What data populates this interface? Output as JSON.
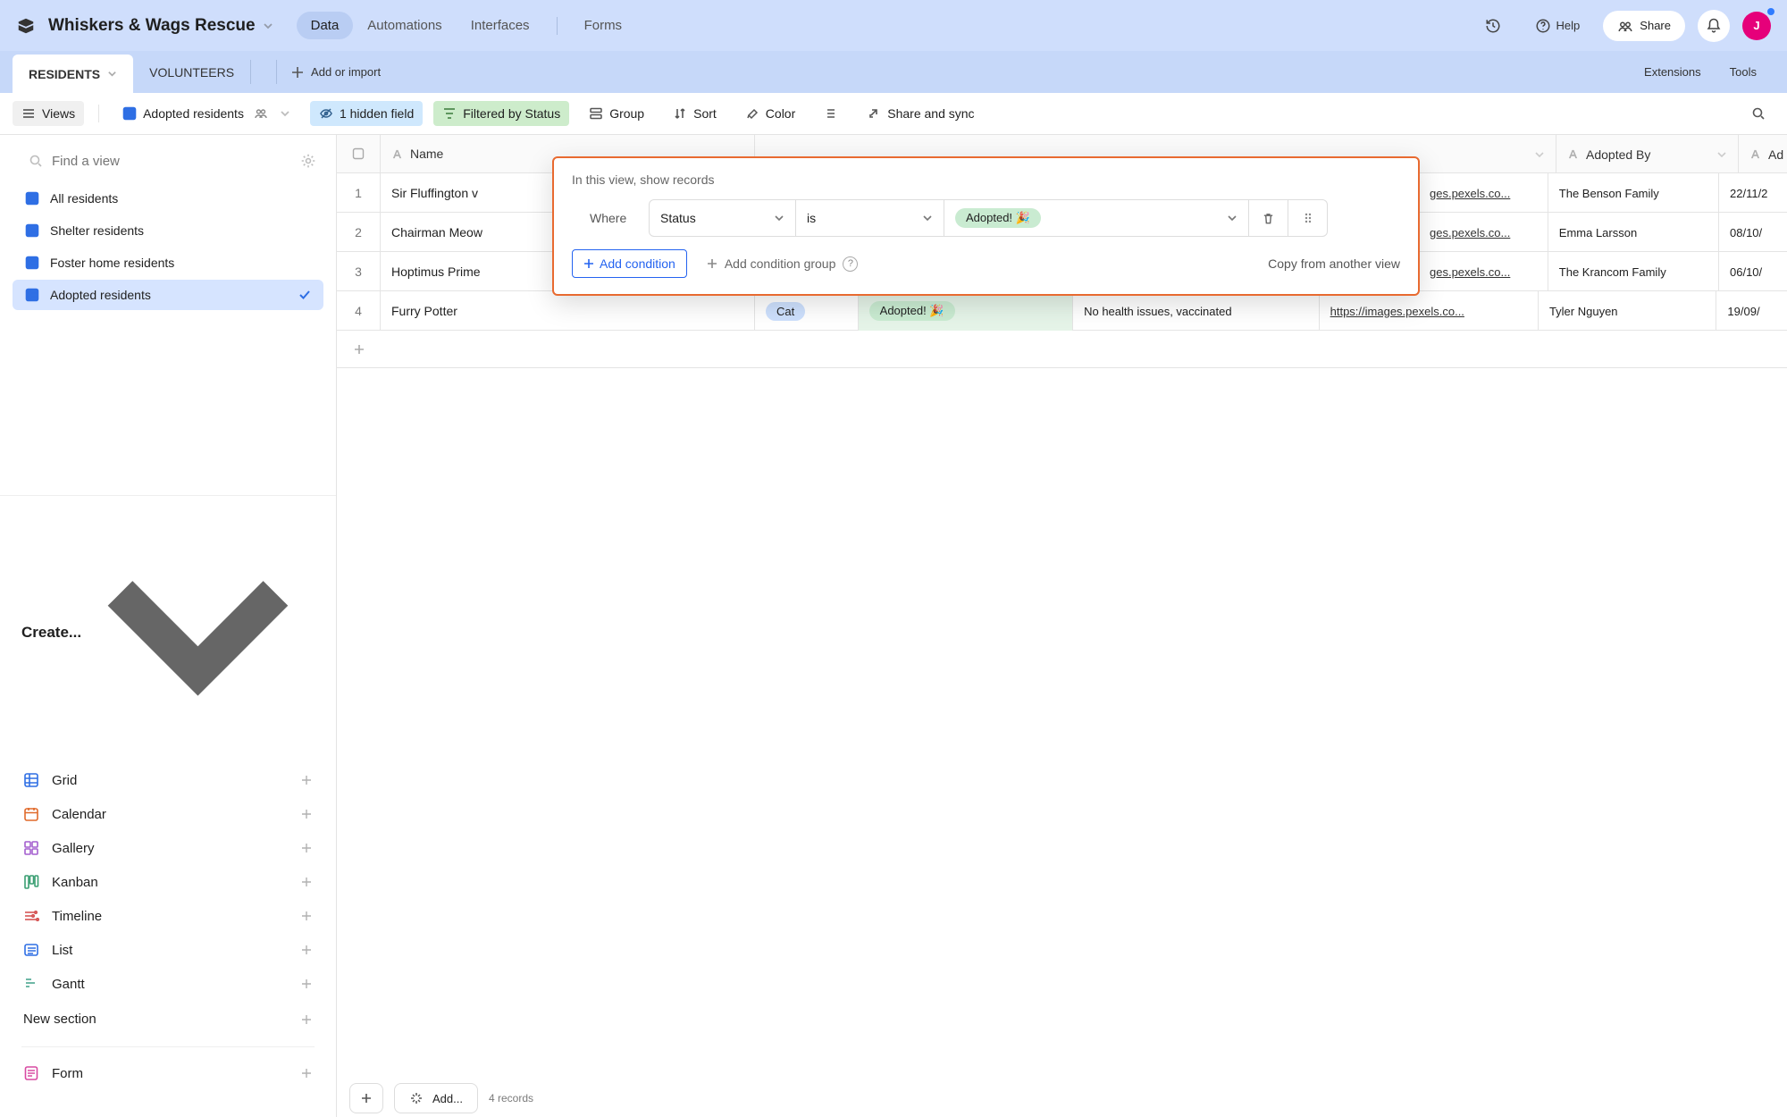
{
  "topbar": {
    "base_name": "Whiskers & Wags Rescue",
    "tabs": {
      "data": "Data",
      "automations": "Automations",
      "interfaces": "Interfaces",
      "forms": "Forms"
    },
    "help": "Help",
    "share": "Share",
    "avatar_initial": "J"
  },
  "tables_bar": {
    "active": "RESIDENTS",
    "other": "VOLUNTEERS",
    "add_or_import": "Add or import",
    "extensions": "Extensions",
    "tools": "Tools"
  },
  "toolbar": {
    "views": "Views",
    "view_name": "Adopted residents",
    "hidden": "1 hidden field",
    "filtered": "Filtered by Status",
    "group": "Group",
    "sort": "Sort",
    "color": "Color",
    "share_sync": "Share and sync"
  },
  "sidebar": {
    "search_placeholder": "Find a view",
    "views": [
      {
        "label": "All residents"
      },
      {
        "label": "Shelter residents"
      },
      {
        "label": "Foster home residents"
      },
      {
        "label": "Adopted residents",
        "active": true
      }
    ],
    "create_header": "Create...",
    "create_list": [
      {
        "label": "Grid",
        "icon": "grid",
        "color": "#2f6fe4"
      },
      {
        "label": "Calendar",
        "icon": "calendar",
        "color": "#e06a2b"
      },
      {
        "label": "Gallery",
        "icon": "gallery",
        "color": "#a45fcf"
      },
      {
        "label": "Kanban",
        "icon": "kanban",
        "color": "#3a9e72"
      },
      {
        "label": "Timeline",
        "icon": "timeline",
        "color": "#d34a4a"
      },
      {
        "label": "List",
        "icon": "list",
        "color": "#2f6fe4"
      },
      {
        "label": "Gantt",
        "icon": "gantt",
        "color": "#3fa089"
      }
    ],
    "new_section": "New section",
    "form": "Form"
  },
  "grid": {
    "headers": {
      "name": "Name",
      "species_hidden_label": "",
      "status_col": "",
      "medical": "",
      "photo": "",
      "adopted_by": "Adopted By",
      "adopt_date_prefix": "Ad"
    },
    "rows": [
      {
        "num": "1",
        "name": "Sir Fluffington v",
        "species": "",
        "status": "",
        "medical": "",
        "photo": "ges.pexels.co...",
        "adopted_by": "The Benson Family",
        "date": "22/11/2"
      },
      {
        "num": "2",
        "name": "Chairman Meow",
        "species": "",
        "status": "",
        "medical": "",
        "photo": "ges.pexels.co...",
        "adopted_by": "Emma Larsson",
        "date": "08/10/"
      },
      {
        "num": "3",
        "name": "Hoptimus Prime",
        "species": "",
        "status": "",
        "medical": "",
        "photo": "ges.pexels.co...",
        "adopted_by": "The Krancom Family",
        "date": "06/10/"
      },
      {
        "num": "4",
        "name": "Furry Potter",
        "species": "Cat",
        "status": "Adopted! 🎉",
        "medical": "No health issues, vaccinated",
        "photo": "https://images.pexels.co...",
        "adopted_by": "Tyler Nguyen",
        "date": "19/09/"
      }
    ],
    "add_footer": "Add...",
    "record_count": "4 records"
  },
  "filter": {
    "title": "In this view, show records",
    "where": "Where",
    "field": "Status",
    "op": "is",
    "value": "Adopted! 🎉",
    "add_condition": "Add condition",
    "add_group": "Add condition group",
    "copy": "Copy from another view"
  }
}
